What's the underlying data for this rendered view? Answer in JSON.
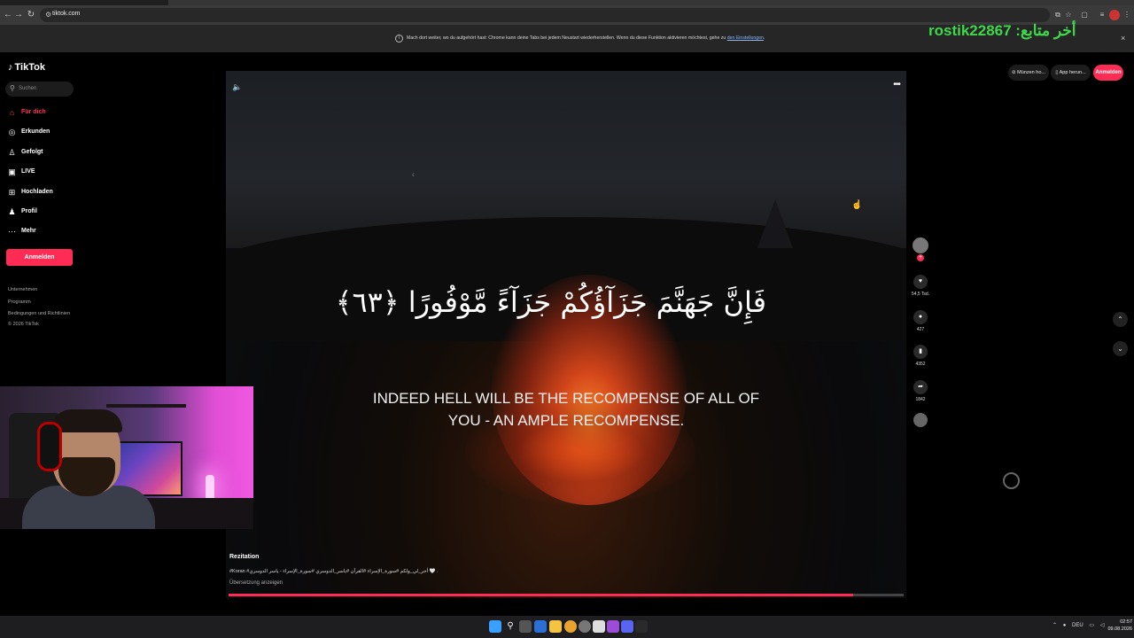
{
  "browser": {
    "url": "tiktok.com",
    "infobar_text": "Mach dort weiter, wo du aufgehört hast: Chrome kann deine Tabs bei jedem Neustart wiederherstellen. Wenn du diese Funktion aktivieren möchtest, gehe zu",
    "infobar_link": "den Einstellungen",
    "infobar_close": "×"
  },
  "stream_overlay": {
    "text": "rostik22867 :أخر متابع"
  },
  "sidebar": {
    "logo": "TikTok",
    "search_placeholder": "Suchen",
    "items": [
      {
        "label": "Für dich",
        "icon": "home-icon",
        "active": true
      },
      {
        "label": "Erkunden",
        "icon": "compass-icon",
        "active": false
      },
      {
        "label": "Gefolgt",
        "icon": "user-follow-icon",
        "active": false
      },
      {
        "label": "LIVE",
        "icon": "live-icon",
        "active": false
      },
      {
        "label": "Hochladen",
        "icon": "upload-icon",
        "active": false
      },
      {
        "label": "Profil",
        "icon": "profile-icon",
        "active": false
      },
      {
        "label": "Mehr",
        "icon": "more-dots-icon",
        "active": false
      }
    ],
    "login_button": "Anmelden",
    "footer_links": [
      "Unternehmen",
      "Programm",
      "Bedingungen und Richtlinien",
      "© 2026 TikTok"
    ]
  },
  "video": {
    "arabic_caption": "فَإِنَّ جَهَنَّمَ جَزَآؤُكُمْ جَزَآءً مَّوْفُورًا ﴿٦٣﴾",
    "translation": "INDEED HELL WILL BE THE RECOMPENSE OF ALL OF YOU - AN AMPLE RECOMPENSE.",
    "progress": 0.925
  },
  "actions": {
    "likes": "54,5 Tsd.",
    "comments": "427",
    "saves": "4352",
    "shares": "1842"
  },
  "top_right": {
    "coins_button": "Münzen ho...",
    "app_button": "App herun...",
    "login_button": "Anmelden"
  },
  "description": {
    "title": "Rezitation",
    "text": "#Koran #أجر_لي_ولكم #سورة_الإسراء #القرآن #ياسر_الدوسري #سورة_الإسراء - ياسر الدوسري 🤍 .",
    "translate_link": "Übersetzung anzeigen"
  },
  "taskbar": {
    "lang": "DEU",
    "time": "02:57",
    "date": "09.08.2026"
  }
}
